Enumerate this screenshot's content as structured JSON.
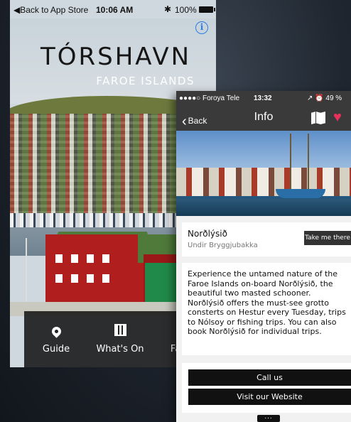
{
  "guide_screen": {
    "status_back": "◀Back to App Store",
    "time": "10:06 AM",
    "bluetooth": "✱",
    "battery": "100%",
    "title": "TÓRSHAVN",
    "subtitle": "FAROE ISLANDS",
    "info_glyph": "i",
    "tabs": [
      {
        "label": "Guide",
        "icon": "map-pin-icon"
      },
      {
        "label": "What's On",
        "icon": "calendar-icon"
      },
      {
        "label": "Favou",
        "icon": "heart-icon"
      }
    ]
  },
  "info_screen": {
    "carrier": "●●●●○ Foroya Tele",
    "time": "13:32",
    "battery": "↗ ⏰ 49 %",
    "nav_back": "Back",
    "nav_title": "Info",
    "place_name": "Norðlýsið",
    "place_location": "Undir Bryggjubakka",
    "take_me_there": "Take me there",
    "description": "Experience the untamed nature of the Faroe Islands on-board Norðlýsið, the beautiful two masted schooner. Norðlýsið offers the must-see grotto consterts on Hestur every Tuesday, trips to Nólsoy or fishing trips. You can also book Norðlýsið for individual trips.",
    "call_label": "Call us",
    "website_label": "Visit our Website",
    "more_glyph": "..."
  },
  "colors": {
    "accent_heart": "#e8315a",
    "nav_bar": "#3a3a3a",
    "info_blue": "#2c7be5"
  }
}
